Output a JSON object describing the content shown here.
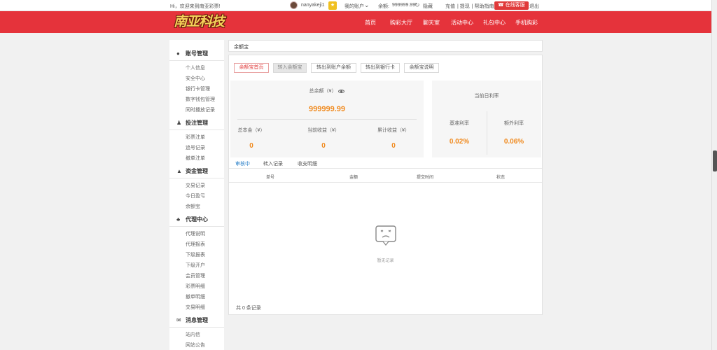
{
  "topbar": {
    "welcome": "Hi，欢迎来到南亚彩票!",
    "username": "nanyakeji1",
    "badge": "★",
    "my_account": "我的账户",
    "balance_label": "余额:",
    "balance_value": "999999.99",
    "hide": "隐藏",
    "links": [
      "充值",
      "提现",
      "帮助指南"
    ],
    "service": "在线客服",
    "logout": "退出"
  },
  "header": {
    "logo": "南亚科技",
    "nav": [
      "首页",
      "购彩大厅",
      "聊天室",
      "活动中心",
      "礼包中心",
      "手机购彩"
    ]
  },
  "sidebar": {
    "groups": [
      {
        "title": "账号管理",
        "icon": "user-icon",
        "items": [
          "个人信息",
          "安全中心",
          "银行卡管理",
          "数字钱包管理",
          "同时播放记录"
        ]
      },
      {
        "title": "投注管理",
        "icon": "bag-icon",
        "items": [
          "彩票注单",
          "追号记录",
          "撤单注单"
        ]
      },
      {
        "title": "资金管理",
        "icon": "money-icon",
        "items": [
          "交易记录",
          "今日盈亏",
          "余额宝"
        ]
      },
      {
        "title": "代理中心",
        "icon": "agents-icon",
        "items": [
          "代理说明",
          "代理报表",
          "下级报表",
          "下级开户",
          "会员管理",
          "彩票明细",
          "撤单明细",
          "交易明细"
        ]
      },
      {
        "title": "消息管理",
        "icon": "mail-icon",
        "items": [
          "站内信",
          "网站公告"
        ]
      }
    ]
  },
  "panel": {
    "title": "余额宝",
    "tabs": [
      "余额宝首页",
      "转入余额宝",
      "转出到账户余额",
      "转出到银行卡",
      "余额宝说明"
    ],
    "total_balance_label": "总余额（¥）",
    "total_balance_value": "999999.99",
    "principal_label": "总本金（¥）",
    "principal_value": "0",
    "current_income_label": "当前收益（¥）",
    "current_income_value": "0",
    "cumulative_income_label": "累计收益（¥）",
    "cumulative_income_value": "0",
    "daily_rate_label": "当前日利率",
    "base_rate_label": "基准利率",
    "base_rate_value": "0.02%",
    "extra_rate_label": "额外利率",
    "extra_rate_value": "0.06%",
    "subtabs": [
      "审核中",
      "转入记录",
      "收支明细"
    ],
    "columns": [
      "单号",
      "金额",
      "提交时间",
      "状态"
    ],
    "empty_text": "暂无记录",
    "total_records": "共 0 条记录"
  },
  "colors": {
    "brand_red": "#e5333b",
    "accent_orange": "#f08a1e",
    "link_blue": "#2a80c8"
  }
}
